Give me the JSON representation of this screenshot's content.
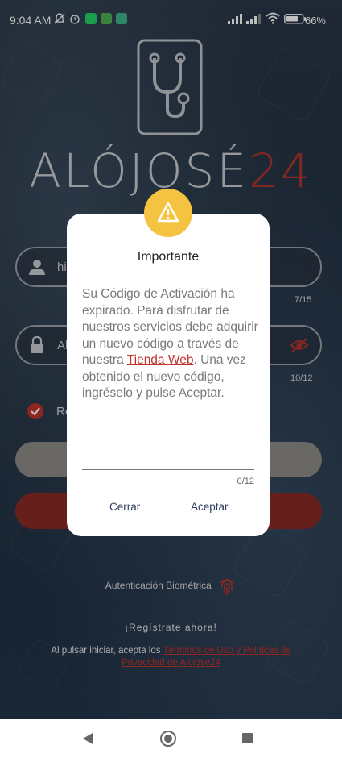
{
  "status_bar": {
    "time": "9:04 AM",
    "battery": "66%"
  },
  "brand": {
    "name_letters": "ALÓJOSÉ",
    "name_number": "24"
  },
  "login_form": {
    "username_value": "hi",
    "username_counter": "7/15",
    "password_value": "Al",
    "password_counter": "10/12",
    "remember_label": "Re"
  },
  "biometric": {
    "label": "Autenticación Biométrica"
  },
  "signup": {
    "label": "¡Regístrate ahora!"
  },
  "terms": {
    "prefix": "Al pulsar iniciar, acepta los ",
    "link": "Términos de Uso y Políticas de Privacidad de Alojose24"
  },
  "dialog": {
    "title": "Importante",
    "message_before": "Su Código de Activación ha expirado. Para disfrutar de nuestros servicios debe adquirir un nuevo código a través de nuestra ",
    "message_link": "Tienda Web",
    "message_after": ". Una vez obtenido el nuevo código, ingréselo y pulse Aceptar.",
    "input_value": "",
    "input_counter": "0/12",
    "cancel_label": "Cerrar",
    "accept_label": "Aceptar"
  },
  "colors": {
    "accent_red": "#c0332b",
    "warning_yellow": "#f5c342",
    "dialog_button": "#2c3e62"
  },
  "icons": {
    "warning": "warning-triangle-icon",
    "user": "user-icon",
    "lock": "lock-icon",
    "eye_off": "eye-off-icon",
    "check": "check-circle-icon",
    "fingerprint": "fingerprint-icon"
  }
}
